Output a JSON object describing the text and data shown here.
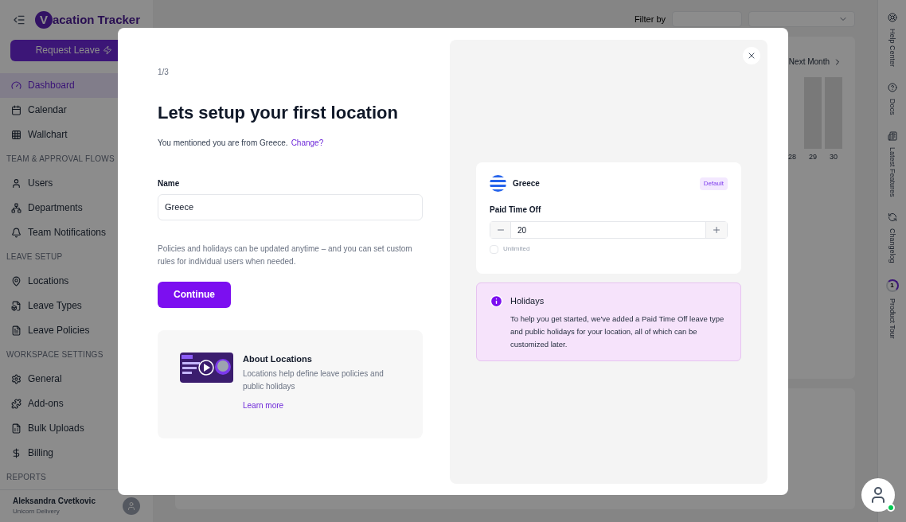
{
  "app": {
    "logo_letter": "V",
    "logo_text": "acation Tracker",
    "request_button": "Request Leave"
  },
  "sidebar": {
    "sections": [
      {
        "items": [
          {
            "label": "Dashboard",
            "selected": true
          },
          {
            "label": "Calendar",
            "selected": false
          },
          {
            "label": "Wallchart",
            "selected": false
          }
        ]
      },
      {
        "heading": "TEAM & APPROVAL FLOWS",
        "items": [
          {
            "label": "Users",
            "selected": false
          },
          {
            "label": "Departments",
            "selected": false
          },
          {
            "label": "Team Notifications",
            "selected": false
          }
        ]
      },
      {
        "heading": "LEAVE SETUP",
        "items": [
          {
            "label": "Locations",
            "selected": false
          },
          {
            "label": "Leave Types",
            "selected": false
          },
          {
            "label": "Leave Policies",
            "selected": false
          }
        ]
      },
      {
        "heading": "WORKSPACE SETTINGS",
        "items": [
          {
            "label": "General",
            "selected": false
          },
          {
            "label": "Add-ons",
            "selected": false
          },
          {
            "label": "Bulk Uploads",
            "selected": false
          },
          {
            "label": "Billing",
            "selected": false
          }
        ]
      },
      {
        "heading": "REPORTS"
      }
    ],
    "user": {
      "name": "Aleksandra Cvetkovic",
      "company": "Unicorn Delivery"
    }
  },
  "main": {
    "filter_label": "Filter by",
    "next_month": "Next Month",
    "days": [
      "28",
      "29",
      "30"
    ]
  },
  "right_rail": [
    {
      "label": "Help Center"
    },
    {
      "label": "Docs"
    },
    {
      "label": "Latest Features"
    },
    {
      "label": "Changelog"
    },
    {
      "label": "Product Tour",
      "badge": "1"
    }
  ],
  "modal": {
    "step": "1/3",
    "title": "Lets setup your first location",
    "subtitle": "You mentioned you are from Greece.",
    "change_link": "Change?",
    "name_label": "Name",
    "name_value": "Greece",
    "note": "Policies and holidays can be updated anytime – and you can set custom rules for individual users when needed.",
    "continue_button": "Continue",
    "about": {
      "title": "About Locations",
      "text": "Locations help define leave policies and public holidays",
      "link": "Learn more"
    },
    "preview": {
      "country": "Greece",
      "badge": "Default",
      "leave_label": "Paid Time Off",
      "days_value": "20",
      "unlimited": {
        "label": "Unlimited",
        "checked": false
      }
    },
    "holidays": {
      "title": "Holidays",
      "text": "To help you get started, we've added a Paid Time Off leave type and public holidays for your location, all of which can be customized later."
    }
  }
}
